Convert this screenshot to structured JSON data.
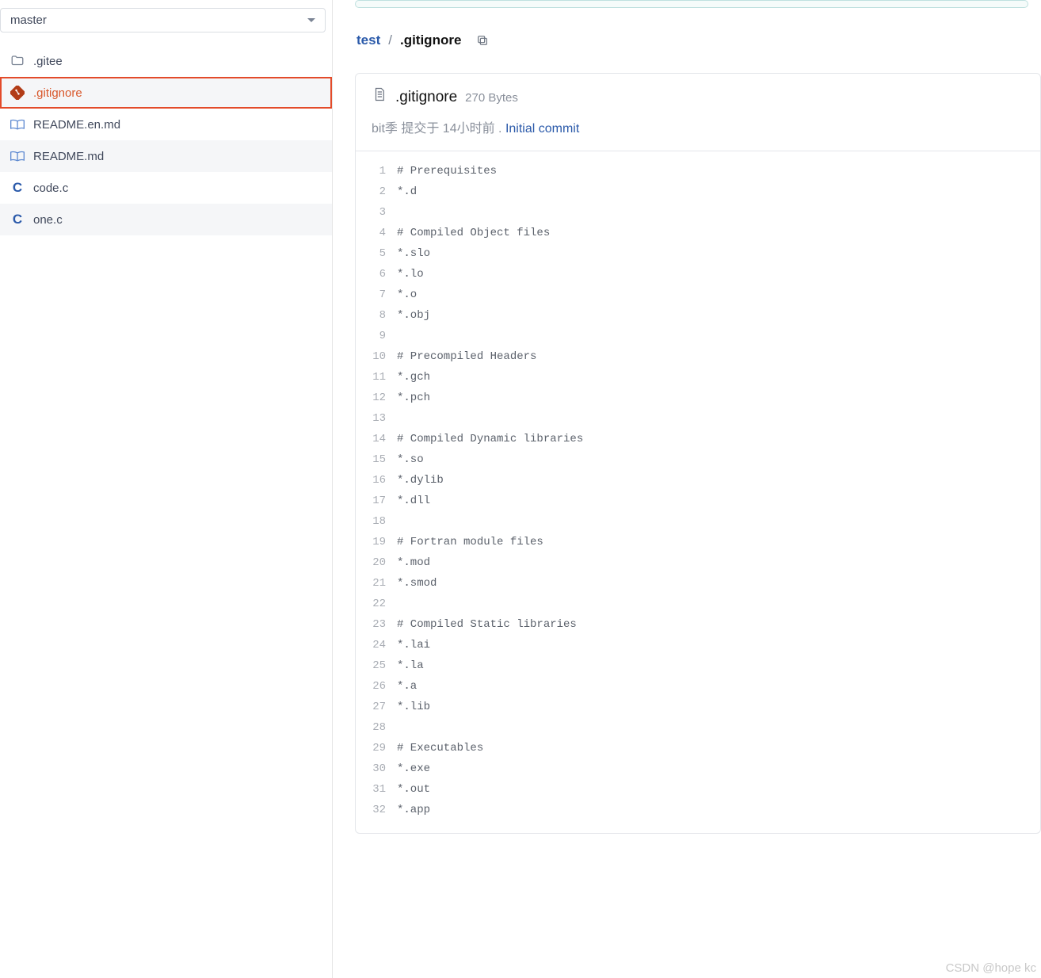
{
  "branch": {
    "name": "master"
  },
  "files": [
    {
      "name": ".gitee",
      "icon": "folder"
    },
    {
      "name": ".gitignore",
      "icon": "git",
      "active": true
    },
    {
      "name": "README.en.md",
      "icon": "book"
    },
    {
      "name": "README.md",
      "icon": "book"
    },
    {
      "name": "code.c",
      "icon": "c"
    },
    {
      "name": "one.c",
      "icon": "c"
    }
  ],
  "breadcrumb": {
    "root": "test",
    "sep": "/",
    "current": ".gitignore"
  },
  "file_header": {
    "icon": "file",
    "name": ".gitignore",
    "size": "270 Bytes"
  },
  "commit": {
    "author": "bit季",
    "info": "提交于 14小时前 .",
    "message": "Initial commit"
  },
  "code_lines": [
    "# Prerequisites",
    "*.d",
    "",
    "# Compiled Object files",
    "*.slo",
    "*.lo",
    "*.o",
    "*.obj",
    "",
    "# Precompiled Headers",
    "*.gch",
    "*.pch",
    "",
    "# Compiled Dynamic libraries",
    "*.so",
    "*.dylib",
    "*.dll",
    "",
    "# Fortran module files",
    "*.mod",
    "*.smod",
    "",
    "# Compiled Static libraries",
    "*.lai",
    "*.la",
    "*.a",
    "*.lib",
    "",
    "# Executables",
    "*.exe",
    "*.out",
    "*.app"
  ],
  "watermark": "CSDN @hope kc"
}
